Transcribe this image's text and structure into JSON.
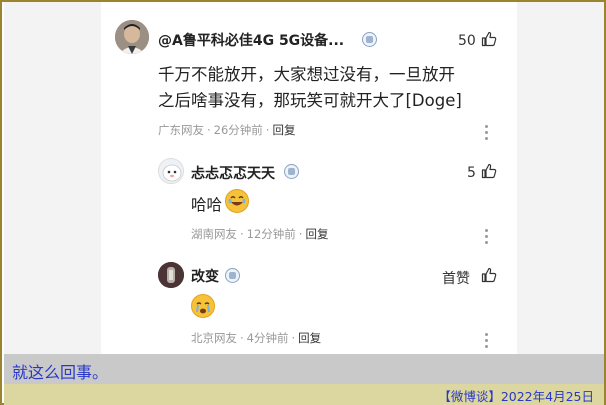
{
  "comments": [
    {
      "username": "@A鲁平科必佳4G 5G设备...",
      "likes": "50",
      "text_line1": "千万不能放开，大家想过没有，一旦放开",
      "text_line2": "之后啥事没有，那玩笑可就开大了[Doge]",
      "location": "广东网友",
      "time": "26分钟前",
      "reply_label": "回复"
    },
    {
      "username": "忐忐忑忑天天",
      "likes": "5",
      "text": "哈哈",
      "location": "湖南网友",
      "time": "12分钟前",
      "reply_label": "回复"
    },
    {
      "username": "改变",
      "likes": "首赞",
      "location": "北京网友",
      "time": "4分钟前",
      "reply_label": "回复"
    }
  ],
  "caption": "就这么回事。",
  "footer": "【微博谈】2022年4月25日",
  "colors": {
    "caption_text": "#2838c8",
    "frame": "#9b8430",
    "footer_bg": "#dcd6a0"
  },
  "icons": [
    "thumbs-up-icon",
    "more-vertical-icon",
    "verified-badge-icon",
    "laughing-emoji-icon",
    "crying-emoji-icon"
  ]
}
